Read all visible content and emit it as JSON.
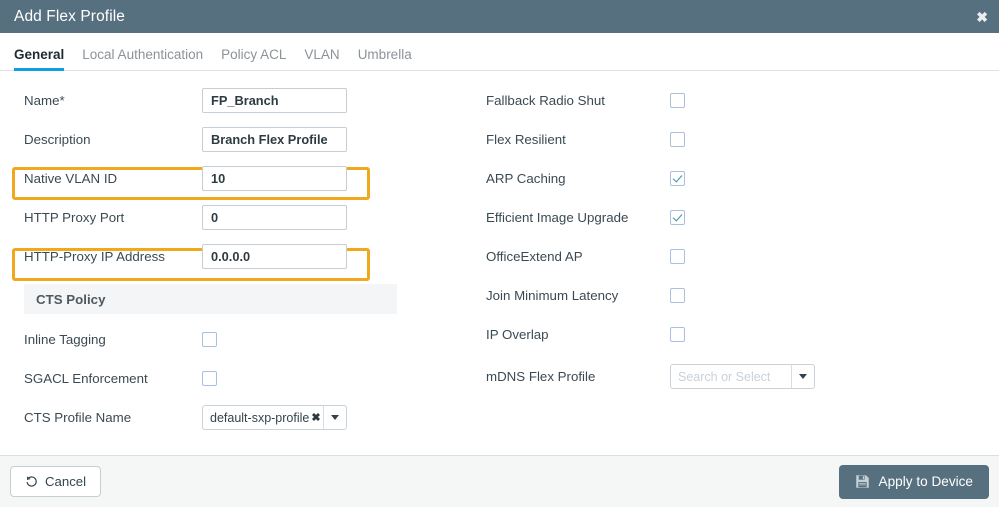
{
  "window": {
    "title": "Add Flex Profile",
    "close_icon": "close-icon",
    "header_color": "#56707f"
  },
  "tabs": [
    {
      "label": "General",
      "active": true
    },
    {
      "label": "Local Authentication",
      "active": false
    },
    {
      "label": "Policy ACL",
      "active": false
    },
    {
      "label": "VLAN",
      "active": false
    },
    {
      "label": "Umbrella",
      "active": false
    }
  ],
  "accent": {
    "tab_underline": "#0f9de6",
    "highlight_border": "#f0a81e",
    "checkbox_border": "#a9c0e0",
    "check_mark": "#3a8fa8"
  },
  "left_column": {
    "fields": [
      {
        "label": "Name*",
        "value": "FP_Branch",
        "highlighted": true
      },
      {
        "label": "Description",
        "value": "Branch Flex Profile",
        "highlighted": false
      },
      {
        "label": "Native VLAN ID",
        "value": "10",
        "highlighted": true
      },
      {
        "label": "HTTP Proxy Port",
        "value": "0",
        "highlighted": false
      },
      {
        "label": "HTTP-Proxy IP Address",
        "value": "0.0.0.0",
        "highlighted": false
      }
    ],
    "section": {
      "title": "CTS Policy"
    },
    "cts_fields": [
      {
        "label": "Inline Tagging",
        "checked": false
      },
      {
        "label": "SGACL Enforcement",
        "checked": false
      }
    ],
    "cts_profile": {
      "label": "CTS Profile Name",
      "value": "default-sxp-profile",
      "remove_icon": "remove-tag-icon",
      "caret_icon": "chevron-down-icon"
    }
  },
  "right_column": {
    "checkboxes": [
      {
        "label": "Fallback Radio Shut",
        "checked": false
      },
      {
        "label": "Flex Resilient",
        "checked": false
      },
      {
        "label": "ARP Caching",
        "checked": true
      },
      {
        "label": "Efficient Image Upgrade",
        "checked": true
      },
      {
        "label": "OfficeExtend AP",
        "checked": false
      },
      {
        "label": "Join Minimum Latency",
        "checked": false
      },
      {
        "label": "IP Overlap",
        "checked": false
      }
    ],
    "mdns": {
      "label": "mDNS Flex Profile",
      "value": "",
      "placeholder": "Search or Select",
      "caret_icon": "chevron-down-icon"
    }
  },
  "footer": {
    "cancel_label": "Cancel",
    "cancel_icon": "undo-icon",
    "apply_label": "Apply to Device",
    "apply_icon": "save-icon"
  }
}
